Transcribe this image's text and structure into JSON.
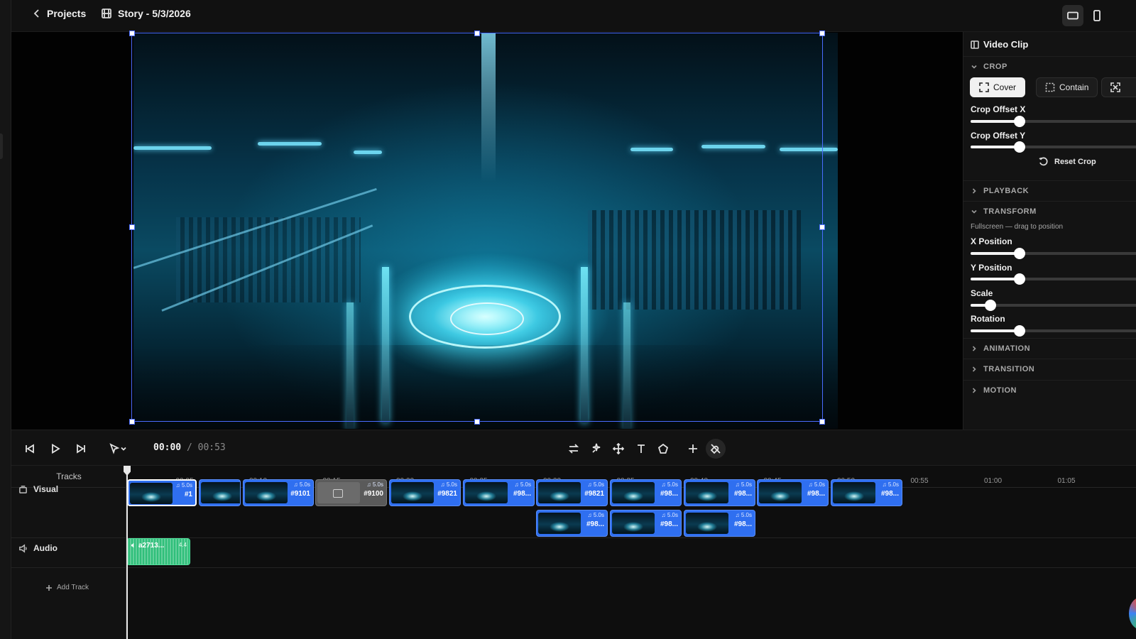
{
  "header": {
    "back_label": "Projects",
    "project_title": "Story - 5/3/2026",
    "icons": [
      "chevron-left-icon",
      "film-icon",
      "landscape-view-icon",
      "portrait-view-icon"
    ]
  },
  "panel": {
    "title": "Video Clip",
    "crop": {
      "section_label": "CROP",
      "modes": [
        "Cover",
        "Contain"
      ],
      "active_mode": "Cover",
      "offset_x_label": "Crop Offset X",
      "offset_x_value": 0.5,
      "offset_y_label": "Crop Offset Y",
      "offset_y_value": 0.5,
      "reset_label": "Reset Crop"
    },
    "playback_label": "PLAYBACK",
    "transform": {
      "section_label": "TRANSFORM",
      "hint": "Fullscreen — drag to position",
      "x_label": "X Position",
      "x_value": 0.5,
      "y_label": "Y Position",
      "y_value": 0.5,
      "scale_label": "Scale",
      "scale_value": 0.2,
      "rotation_label": "Rotation",
      "rotation_value": 0.5
    },
    "animation_label": "ANIMATION",
    "transition_label": "TRANSITION",
    "motion_label": "MOTION"
  },
  "transport": {
    "current_time": "00:00",
    "separator": "/",
    "total_time": "00:53"
  },
  "timeline": {
    "tracks_title": "Tracks",
    "visual_label": "Visual",
    "audio_label": "Audio",
    "add_track_label": "Add Track",
    "ticks": [
      "00:05",
      "00:10",
      "00:15",
      "00:20",
      "00:25",
      "00:30",
      "00:35",
      "00:40",
      "00:45",
      "00:50",
      "00:55",
      "01:00",
      "01:05"
    ],
    "visual_row1": [
      {
        "id": "#1",
        "dur": "♫ 5.0s",
        "selected": true
      },
      {
        "id": "",
        "dur": ""
      },
      {
        "id": "#9101",
        "dur": "♫ 5.0s"
      },
      {
        "id": "#9100",
        "dur": "♫ 5.0s",
        "grey": true
      },
      {
        "id": "#9821",
        "dur": "♫ 5.0s"
      },
      {
        "id": "#98...",
        "dur": "♫ 5.0s"
      },
      {
        "id": "#9821",
        "dur": "♫ 5.0s"
      },
      {
        "id": "#98...",
        "dur": "♫ 5.0s"
      },
      {
        "id": "#98...",
        "dur": "♫ 5.0s"
      },
      {
        "id": "#98...",
        "dur": "♫ 5.0s"
      },
      {
        "id": "#98...",
        "dur": "♫ 5.0s"
      }
    ],
    "visual_row2": [
      {
        "id": "#98...",
        "dur": "♫ 5.0s"
      },
      {
        "id": "#98...",
        "dur": "♫ 5.0s"
      },
      {
        "id": "#98...",
        "dur": "♫ 5.0s"
      }
    ],
    "audio_clip": {
      "label": "a2713...",
      "dur": "4.4"
    }
  }
}
